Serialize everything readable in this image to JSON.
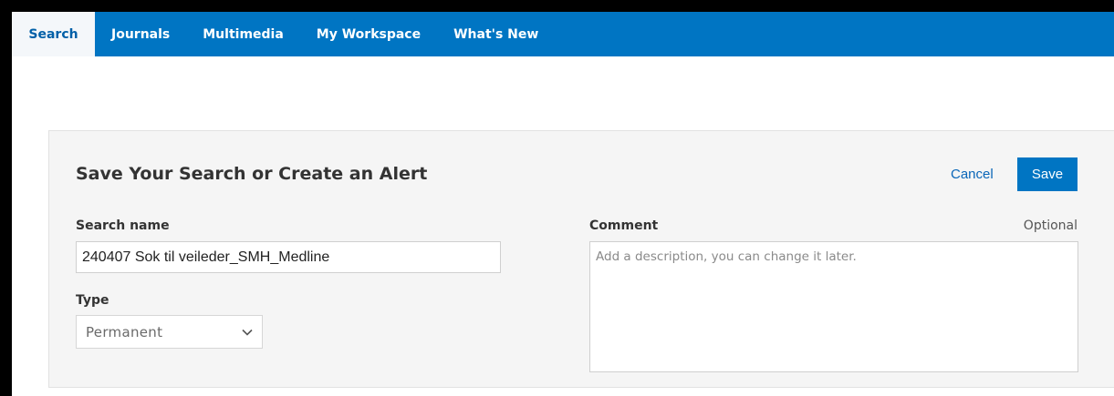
{
  "nav": {
    "tabs": [
      {
        "label": "Search",
        "active": true
      },
      {
        "label": "Journals"
      },
      {
        "label": "Multimedia"
      },
      {
        "label": "My Workspace"
      },
      {
        "label": "What's New"
      }
    ]
  },
  "dialog": {
    "title": "Save Your Search or Create an Alert",
    "cancel_label": "Cancel",
    "save_label": "Save",
    "search_name_label": "Search name",
    "search_name_value": "240407 Sok til veileder_SMH_Medline",
    "type_label": "Type",
    "type_value": "Permanent",
    "comment_label": "Comment",
    "optional_label": "Optional",
    "comment_placeholder": "Add a description, you can change it later."
  },
  "colors": {
    "nav_bg": "#0075c3",
    "active_tab_bg": "#f4f7fa",
    "primary_button": "#0075c3",
    "link": "#0a66b8",
    "panel_bg": "#f5f5f5"
  },
  "icons": {
    "type_select_caret": "chevron-down-icon"
  }
}
